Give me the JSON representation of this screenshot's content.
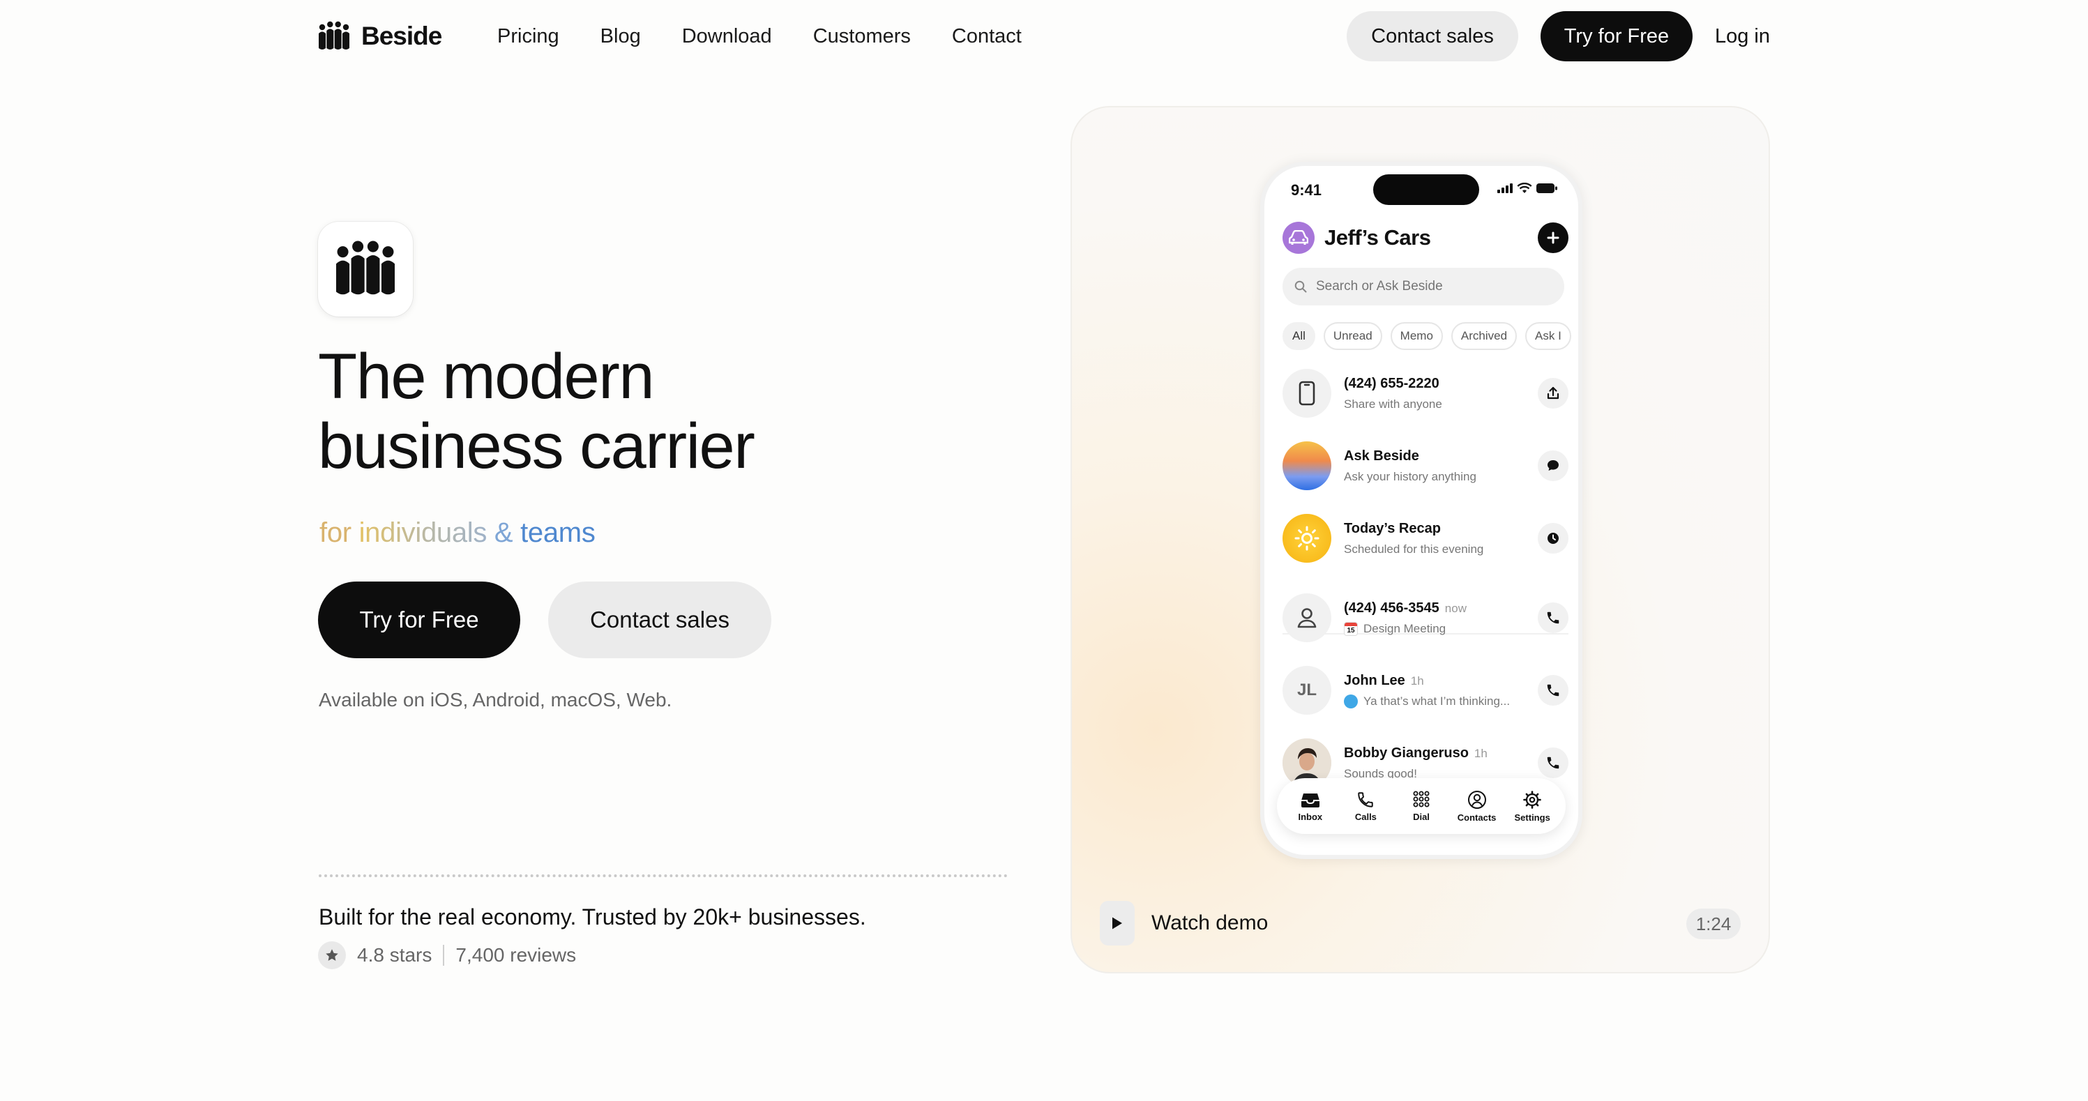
{
  "nav": {
    "brand": "Beside",
    "links": [
      "Pricing",
      "Blog",
      "Download",
      "Customers",
      "Contact"
    ],
    "contact_sales": "Contact sales",
    "try_free": "Try for Free",
    "login": "Log in"
  },
  "hero": {
    "title_line1": "The modern",
    "title_line2": "business carrier",
    "subtitle": {
      "w1": "for ",
      "w2": "individuals",
      "w3": " & ",
      "w4": "teams"
    },
    "cta_try": "Try for Free",
    "cta_contact": "Contact sales",
    "availability": "Available on iOS, Android, macOS, Web.",
    "trust": "Built for the real economy. Trusted by 20k+ businesses.",
    "rating_stars": "4.8 stars",
    "rating_reviews": "7,400 reviews"
  },
  "demo": {
    "watch_label": "Watch demo",
    "duration": "1:24"
  },
  "phone": {
    "time": "9:41",
    "org_name": "Jeff’s Cars",
    "search_placeholder": "Search or Ask Beside",
    "chips": [
      "All",
      "Unread",
      "Memo",
      "Archived",
      "Ask I"
    ],
    "rows": [
      {
        "title": "(424) 655-2220",
        "ago": "",
        "sub": "Share with anyone",
        "avatar": "phone-device-icon",
        "action": "share-icon"
      },
      {
        "title": "Ask Beside",
        "ago": "",
        "sub": "Ask your history anything",
        "avatar": "ask-beside-orb",
        "action": "chat-bubble-icon"
      },
      {
        "title": "Today’s Recap",
        "ago": "",
        "sub": "Scheduled for this evening",
        "avatar": "sun-icon",
        "action": "clock-icon"
      },
      {
        "title": "(424) 456-3545",
        "ago": "now",
        "sub": "Design Meeting",
        "sub_day": "15",
        "avatar": "person-icon",
        "action": "phone-call-icon"
      },
      {
        "title": "John Lee",
        "ago": "1h",
        "sub": "Ya that’s what I’m thinking...",
        "initials": "JL",
        "avatar": "initials-avatar",
        "action": "phone-call-icon"
      },
      {
        "title": "Bobby Giangeruso",
        "ago": "1h",
        "sub": "Sounds good!",
        "avatar": "photo-avatar",
        "action": "phone-call-icon"
      }
    ],
    "tabs": [
      "Inbox",
      "Calls",
      "Dial",
      "Contacts",
      "Settings"
    ]
  },
  "colors": {
    "primary_black": "#0d0d0d",
    "pill_gray": "#ebebeb",
    "org_avatar": "#a776d9",
    "subtitle_gold": "#d9b36e",
    "subtitle_blue": "#4f88cf"
  }
}
